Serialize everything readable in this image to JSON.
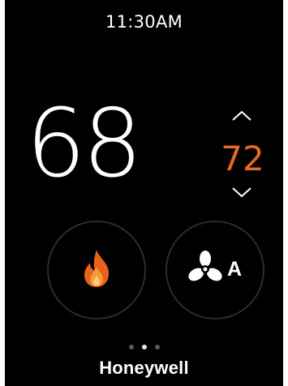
{
  "status_bar": {
    "time": "11:30AM"
  },
  "temperature": {
    "current": "68",
    "setpoint": "72",
    "setpoint_color": "#e86a1e",
    "increase_icon": "chevron-up-icon",
    "decrease_icon": "chevron-down-icon"
  },
  "modes": [
    {
      "id": "heat",
      "icon": "flame-icon",
      "label": ""
    },
    {
      "id": "fan",
      "icon": "fan-icon",
      "label": "A"
    }
  ],
  "pagination": {
    "pages": 3,
    "active": 2
  },
  "brand": {
    "logo_text": "Honeywell"
  },
  "colors": {
    "background": "#000000",
    "text": "#ffffff",
    "accent": "#e86a1e",
    "ring": "#2c2c2c"
  }
}
